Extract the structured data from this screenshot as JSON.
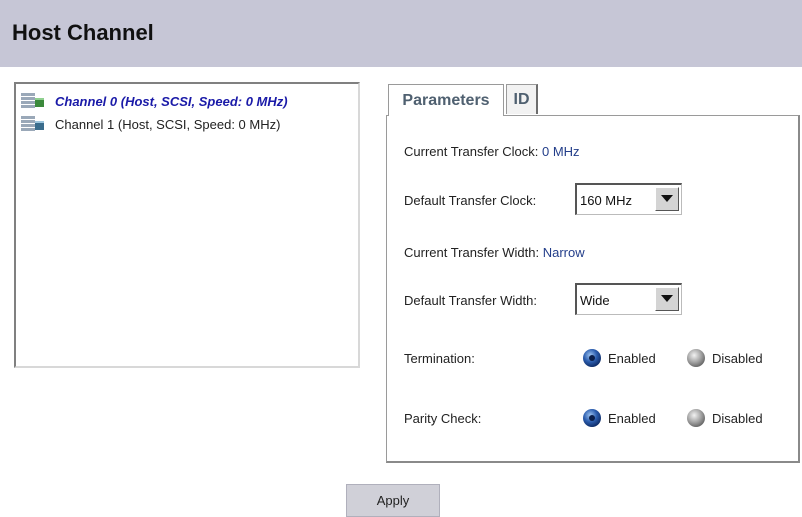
{
  "header": {
    "title": "Host Channel"
  },
  "channels": {
    "items": [
      {
        "label": "Channel 0 (Host, SCSI, Speed: 0 MHz)",
        "selected": true
      },
      {
        "label": "Channel 1 (Host, SCSI, Speed: 0 MHz)",
        "selected": false
      }
    ]
  },
  "tabs": {
    "parameters": "Parameters",
    "id": "ID"
  },
  "params": {
    "current_clock_label": "Current Transfer Clock:",
    "current_clock_value": "0 MHz",
    "default_clock_label": "Default Transfer Clock:",
    "default_clock_value": "160 MHz",
    "current_width_label": "Current Transfer Width:",
    "current_width_value": "Narrow",
    "default_width_label": "Default Transfer Width:",
    "default_width_value": "Wide",
    "termination_label": "Termination:",
    "parity_label": "Parity Check:",
    "enabled": "Enabled",
    "disabled": "Disabled",
    "termination_selected": "Enabled",
    "parity_selected": "Enabled"
  },
  "apply_label": "Apply",
  "colors": {
    "header_bg": "#c6c6d6",
    "selected_text": "#1a1aa8",
    "value_text": "#233e8a"
  }
}
